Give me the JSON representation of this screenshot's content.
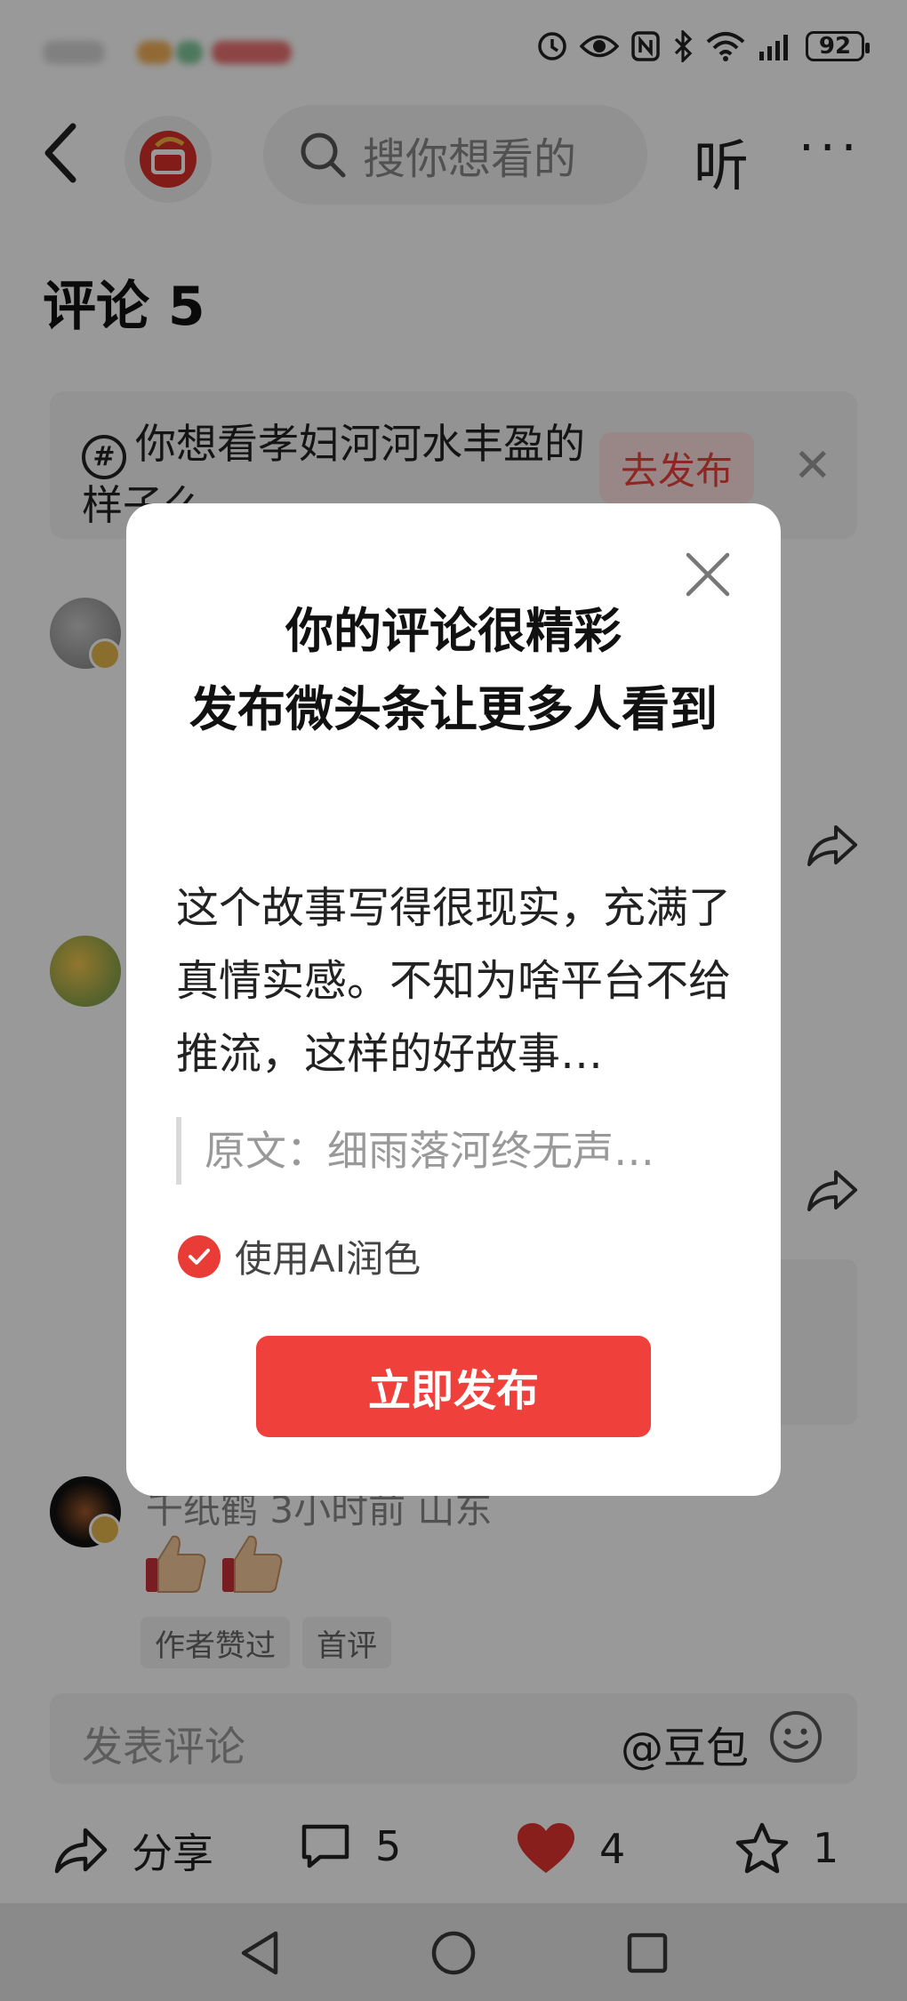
{
  "status_bar": {
    "battery": "92"
  },
  "header": {
    "search_placeholder": "搜你想看的",
    "listen_label": "听",
    "more_label": "···"
  },
  "comments": {
    "title": "评论 5"
  },
  "topic_banner": {
    "text": "你想看孝妇河河水丰盈的样子么",
    "post_button": "去发布",
    "close": "✕"
  },
  "comment_item": {
    "meta": "千纸鹤  3小时前  山东",
    "tags": [
      "作者赞过",
      "首评"
    ]
  },
  "comment_input": {
    "placeholder": "发表评论",
    "mention": "@豆包"
  },
  "actions": {
    "share_label": "分享",
    "comment_count": "5",
    "like_count": "4",
    "favorite_count": "1"
  },
  "dialog": {
    "title_line1": "你的评论很精彩",
    "title_line2": "发布微头条让更多人看到",
    "body": "这个故事写得很现实，充满了真情实感。不知为啥平台不给推流，这样的好故事…",
    "quote": "原文：细雨落河终无声…",
    "ai_polish_label": "使用AI润色",
    "publish_button": "立即发布"
  },
  "colors": {
    "accent": "#f0403b",
    "overlay": "rgba(0,0,0,0.40)"
  }
}
